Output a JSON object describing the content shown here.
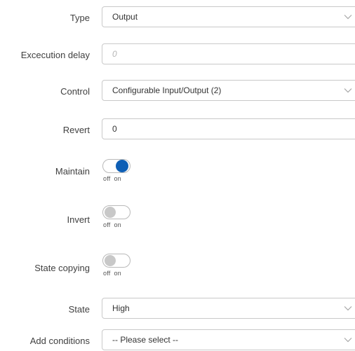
{
  "form": {
    "type": {
      "label": "Type",
      "value": "Output"
    },
    "execution_delay": {
      "label": "Excecution delay",
      "placeholder": "0"
    },
    "control": {
      "label": "Control",
      "value": "Configurable Input/Output (2)"
    },
    "revert": {
      "label": "Revert",
      "value": "0"
    },
    "maintain": {
      "label": "Maintain",
      "state": "on",
      "off_label": "off",
      "on_label": "on"
    },
    "invert": {
      "label": "Invert",
      "state": "off",
      "off_label": "off",
      "on_label": "on"
    },
    "state_copying": {
      "label": "State copying",
      "state": "off",
      "off_label": "off",
      "on_label": "on"
    },
    "state": {
      "label": "State",
      "value": "High"
    },
    "add_conditions": {
      "label": "Add conditions",
      "value": "-- Please select --"
    }
  },
  "colors": {
    "toggle_on": "#0e5fb5",
    "toggle_off_knob": "#c8c8c8",
    "field_border": "#c9c9c9",
    "placeholder": "#b5b5b5"
  },
  "icons": {
    "select_arrow": "chevron-down-icon"
  }
}
